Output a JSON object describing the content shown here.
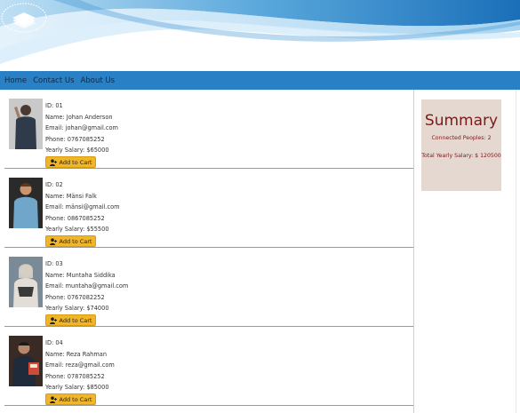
{
  "nav": {
    "items": [
      "Home",
      "Contact Us",
      "About Us"
    ]
  },
  "cart_button_label": "Add to Cart",
  "employees": [
    {
      "id": "ID: 01",
      "name": "Name: Johan Anderson",
      "email": "Email: johan@gmail.com",
      "phone": "Phone: 0767085252",
      "salary": "Yearly Salary: $65000"
    },
    {
      "id": "ID: 02",
      "name": "Name: Mänsi Falk",
      "email": "Email: mänsi@gmail.com",
      "phone": "Phone: 0867085252",
      "salary": "Yearly Salary: $55500"
    },
    {
      "id": "ID: 03",
      "name": "Name: Muntaha Siddika",
      "email": "Email: muntaha@gmail.com",
      "phone": "Phone: 0767082252",
      "salary": "Yearly Salary: $74000"
    },
    {
      "id": "ID: 04",
      "name": "Name: Reza Rahman",
      "email": "Email: reza@gmail.com",
      "phone": "Phone: 0787085252",
      "salary": "Yearly Salary: $85000"
    }
  ],
  "summary": {
    "title": "Summary",
    "connected": "Connected Peoples: 2",
    "total": "Total Yearly Salary: $ 120500"
  },
  "colors": {
    "navbar": "#2a80c4",
    "button": "#f0b528",
    "summary_bg": "#e4d8d0",
    "summary_text": "#7a1a1a"
  },
  "icons": {
    "logo": "book-stack-logo",
    "cart": "user-plus-icon"
  }
}
